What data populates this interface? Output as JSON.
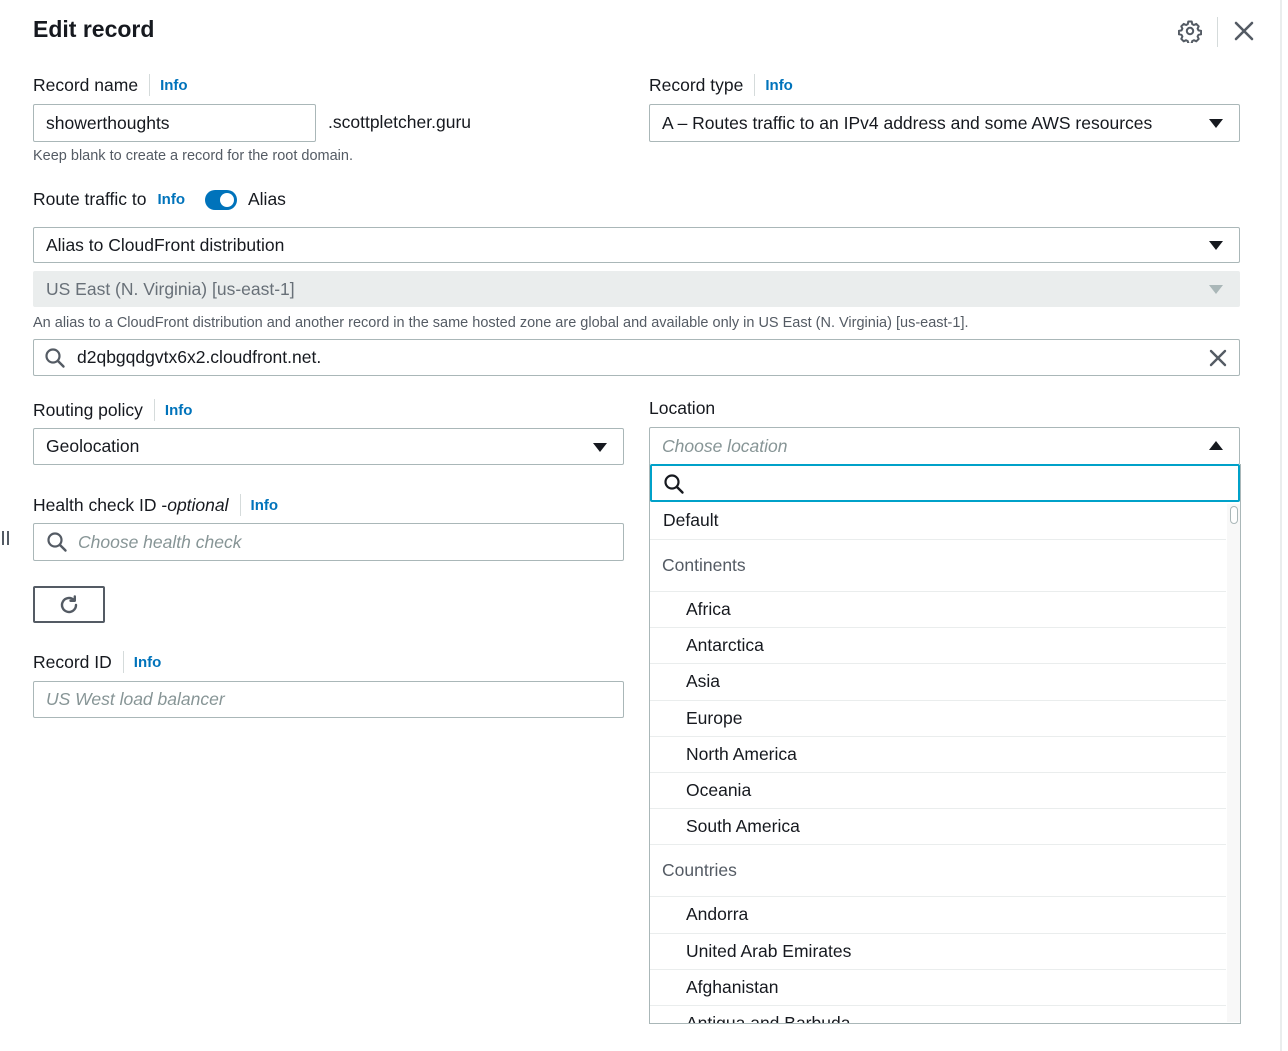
{
  "header": {
    "title": "Edit record",
    "settings_icon": "gear-icon",
    "close_icon": "close-icon"
  },
  "record_name": {
    "label": "Record name",
    "info": "Info",
    "value": "showerthoughts",
    "suffix": ".scottpletcher.guru",
    "hint": "Keep blank to create a record for the root domain."
  },
  "record_type": {
    "label": "Record type",
    "info": "Info",
    "value": "A – Routes traffic to an IPv4 address and some AWS resources"
  },
  "route_traffic": {
    "label": "Route traffic to",
    "info": "Info",
    "toggle_label": "Alias",
    "toggle_on": true,
    "endpoint_value": "Alias to CloudFront distribution",
    "region_value": "US East (N. Virginia) [us-east-1]",
    "region_hint": "An alias to a CloudFront distribution and another record in the same hosted zone are global and available only in US East (N. Virginia) [us-east-1].",
    "distribution_value": "d2qbgqdgvtx6x2.cloudfront.net."
  },
  "routing_policy": {
    "label": "Routing policy",
    "info": "Info",
    "value": "Geolocation"
  },
  "health_check": {
    "label": "Health check ID - ",
    "label_optional": "optional",
    "info": "Info",
    "placeholder": "Choose health check"
  },
  "record_id": {
    "label": "Record ID",
    "info": "Info",
    "placeholder": "US West load balancer"
  },
  "location": {
    "label": "Location",
    "placeholder": "Choose location",
    "search_value": "",
    "default_option": "Default",
    "groups": [
      {
        "label": "Continents",
        "options": [
          "Africa",
          "Antarctica",
          "Asia",
          "Europe",
          "North America",
          "Oceania",
          "South America"
        ]
      },
      {
        "label": "Countries",
        "options": [
          "Andorra",
          "United Arab Emirates",
          "Afghanistan",
          "Antigua and Barbuda"
        ]
      }
    ]
  },
  "colors": {
    "accent": "#0073bb",
    "focus": "#00a1c9",
    "text": "#16191f",
    "muted": "#545b64"
  }
}
